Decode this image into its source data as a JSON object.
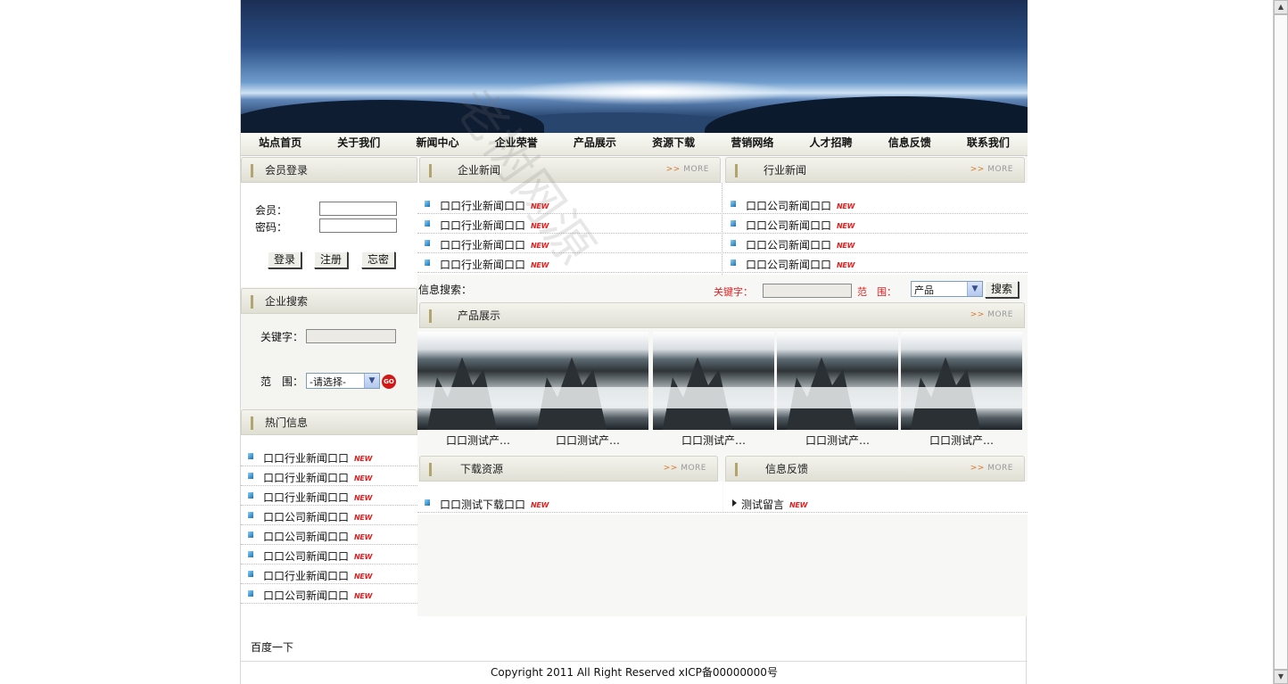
{
  "nav": [
    "站点首页",
    "关于我们",
    "新闻中心",
    "企业荣誉",
    "产品展示",
    "资源下载",
    "营销网络",
    "人才招聘",
    "信息反馈",
    "联系我们"
  ],
  "login": {
    "title": "会员登录",
    "user_label": "会员：",
    "pass_label": "密码：",
    "login_btn": "登录",
    "register_btn": "注册",
    "forgot_btn": "忘密"
  },
  "company_search": {
    "title": "企业搜索",
    "keyword_label": "关键字：",
    "scope_label": "范　围：",
    "scope_value": "-请选择-",
    "go_label": "GO"
  },
  "hot": {
    "title": "热门信息",
    "items": [
      "口口行业新闻口口",
      "口口行业新闻口口",
      "口口行业新闻口口",
      "口口公司新闻口口",
      "口口公司新闻口口",
      "口口公司新闻口口",
      "口口行业新闻口口",
      "口口公司新闻口口"
    ]
  },
  "company_news": {
    "title": "企业新闻",
    "more": "MORE",
    "items": [
      "口口行业新闻口口",
      "口口行业新闻口口",
      "口口行业新闻口口",
      "口口行业新闻口口"
    ]
  },
  "industry_news": {
    "title": "行业新闻",
    "more": "MORE",
    "items": [
      "口口公司新闻口口",
      "口口公司新闻口口",
      "口口公司新闻口口",
      "口口公司新闻口口"
    ]
  },
  "info_search": {
    "label": "信息搜索：",
    "keyword_label": "关键字：",
    "scope_label": "范　围：",
    "scope_value": "产品",
    "search_btn": "搜索"
  },
  "products": {
    "title": "产品展示",
    "more": "MORE",
    "items": [
      "口口测试产…",
      "口口测试产…",
      "口口测试产…",
      "口口测试产…",
      "口口测试产…"
    ]
  },
  "downloads": {
    "title": "下载资源",
    "more": "MORE",
    "items": [
      "口口测试下载口口"
    ]
  },
  "feedback": {
    "title": "信息反馈",
    "more": "MORE",
    "items": [
      "测试留言"
    ]
  },
  "new_tag": "NEW",
  "more_arrow": ">>",
  "footer": {
    "link": "百度一下",
    "copyright": "Copyright 2011 All Right Reserved  xICP备00000000号"
  },
  "watermark": "老树网源",
  "colors": {
    "accent_bar": "#b2a46c",
    "new_tag": "#e02020",
    "keyword_red": "#e02020"
  }
}
